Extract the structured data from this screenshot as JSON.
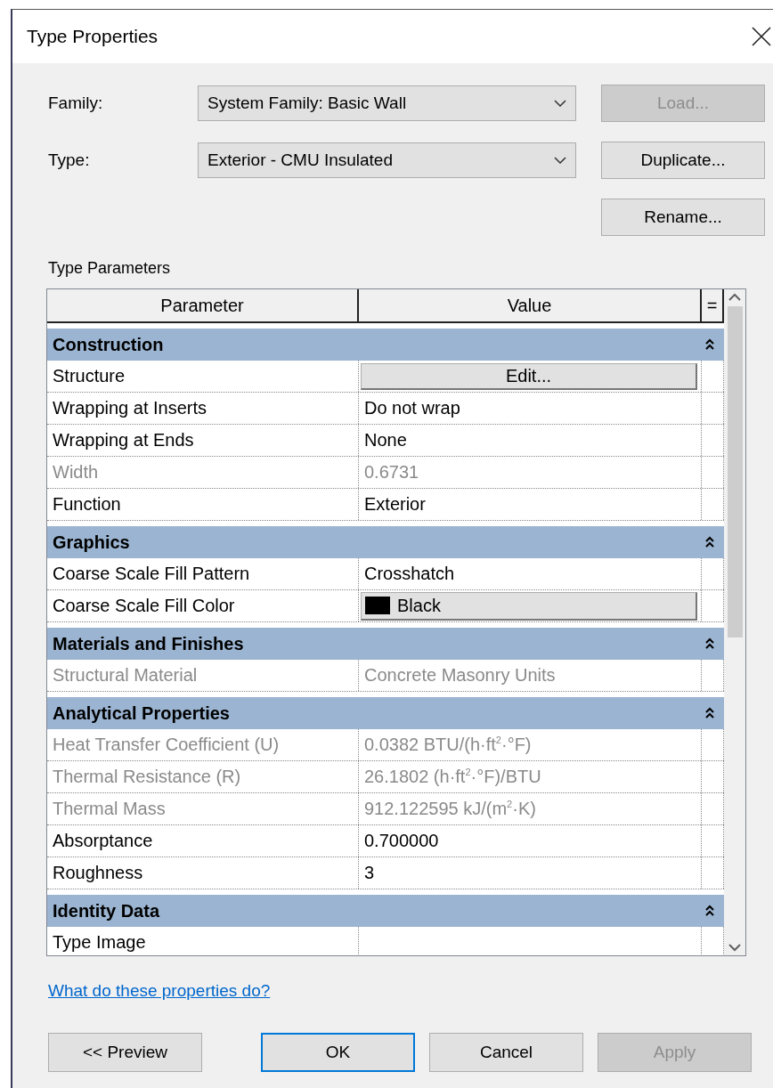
{
  "window": {
    "title": "Type Properties"
  },
  "family": {
    "label": "Family:",
    "value": "System Family: Basic Wall"
  },
  "type": {
    "label": "Type:",
    "value": "Exterior - CMU Insulated"
  },
  "side_buttons": [
    {
      "label": "Load...",
      "disabled": true
    },
    {
      "label": "Duplicate...",
      "disabled": false
    },
    {
      "label": "Rename...",
      "disabled": false
    }
  ],
  "section_label": "Type Parameters",
  "table": {
    "columns": [
      "Parameter",
      "Value",
      "="
    ],
    "groups": [
      {
        "name": "Construction",
        "expanded": true,
        "rows": [
          {
            "kind": "button",
            "name": "Structure",
            "value": "Edit...",
            "disabled": false
          },
          {
            "kind": "text",
            "name": "Wrapping at Inserts",
            "value": "Do not wrap",
            "disabled": false
          },
          {
            "kind": "text",
            "name": "Wrapping at Ends",
            "value": "None",
            "disabled": false
          },
          {
            "kind": "text",
            "name": "Width",
            "value": "0.6731",
            "disabled": true
          },
          {
            "kind": "text",
            "name": "Function",
            "value": "Exterior",
            "disabled": false
          }
        ]
      },
      {
        "name": "Graphics",
        "expanded": true,
        "rows": [
          {
            "kind": "text",
            "name": "Coarse Scale Fill Pattern",
            "value": "Crosshatch",
            "disabled": false
          },
          {
            "kind": "color",
            "name": "Coarse Scale Fill Color",
            "value": "Black",
            "color": "#000000",
            "disabled": false
          }
        ]
      },
      {
        "name": "Materials and Finishes",
        "expanded": true,
        "rows": [
          {
            "kind": "text",
            "name": "Structural Material",
            "value": "Concrete Masonry Units",
            "disabled": true
          }
        ]
      },
      {
        "name": "Analytical Properties",
        "expanded": true,
        "rows": [
          {
            "kind": "text",
            "name": "Heat Transfer Coefficient (U)",
            "value": "0.0382 BTU/(h·ft$^{2}$·°F)",
            "disabled": true
          },
          {
            "kind": "text",
            "name": "Thermal Resistance (R)",
            "value": "26.1802 (h·ft$^{2}$·°F)/BTU",
            "disabled": true
          },
          {
            "kind": "text",
            "name": "Thermal Mass",
            "value": "912.122595 kJ/(m$^{2}$·K)",
            "disabled": true
          },
          {
            "kind": "text",
            "name": "Absorptance",
            "value": "0.700000",
            "disabled": false
          },
          {
            "kind": "text",
            "name": "Roughness",
            "value": "3",
            "disabled": false
          }
        ]
      },
      {
        "name": "Identity Data",
        "expanded": true,
        "rows": [
          {
            "kind": "text",
            "name": "Type Image",
            "value": "",
            "disabled": false
          }
        ]
      }
    ]
  },
  "help_link": "What do these properties do?",
  "footer_buttons": [
    {
      "label": "<< Preview",
      "default": false,
      "disabled": false
    },
    {
      "label": "OK",
      "default": true,
      "disabled": false
    },
    {
      "label": "Cancel",
      "default": false,
      "disabled": false
    },
    {
      "label": "Apply",
      "default": false,
      "disabled": true
    }
  ]
}
